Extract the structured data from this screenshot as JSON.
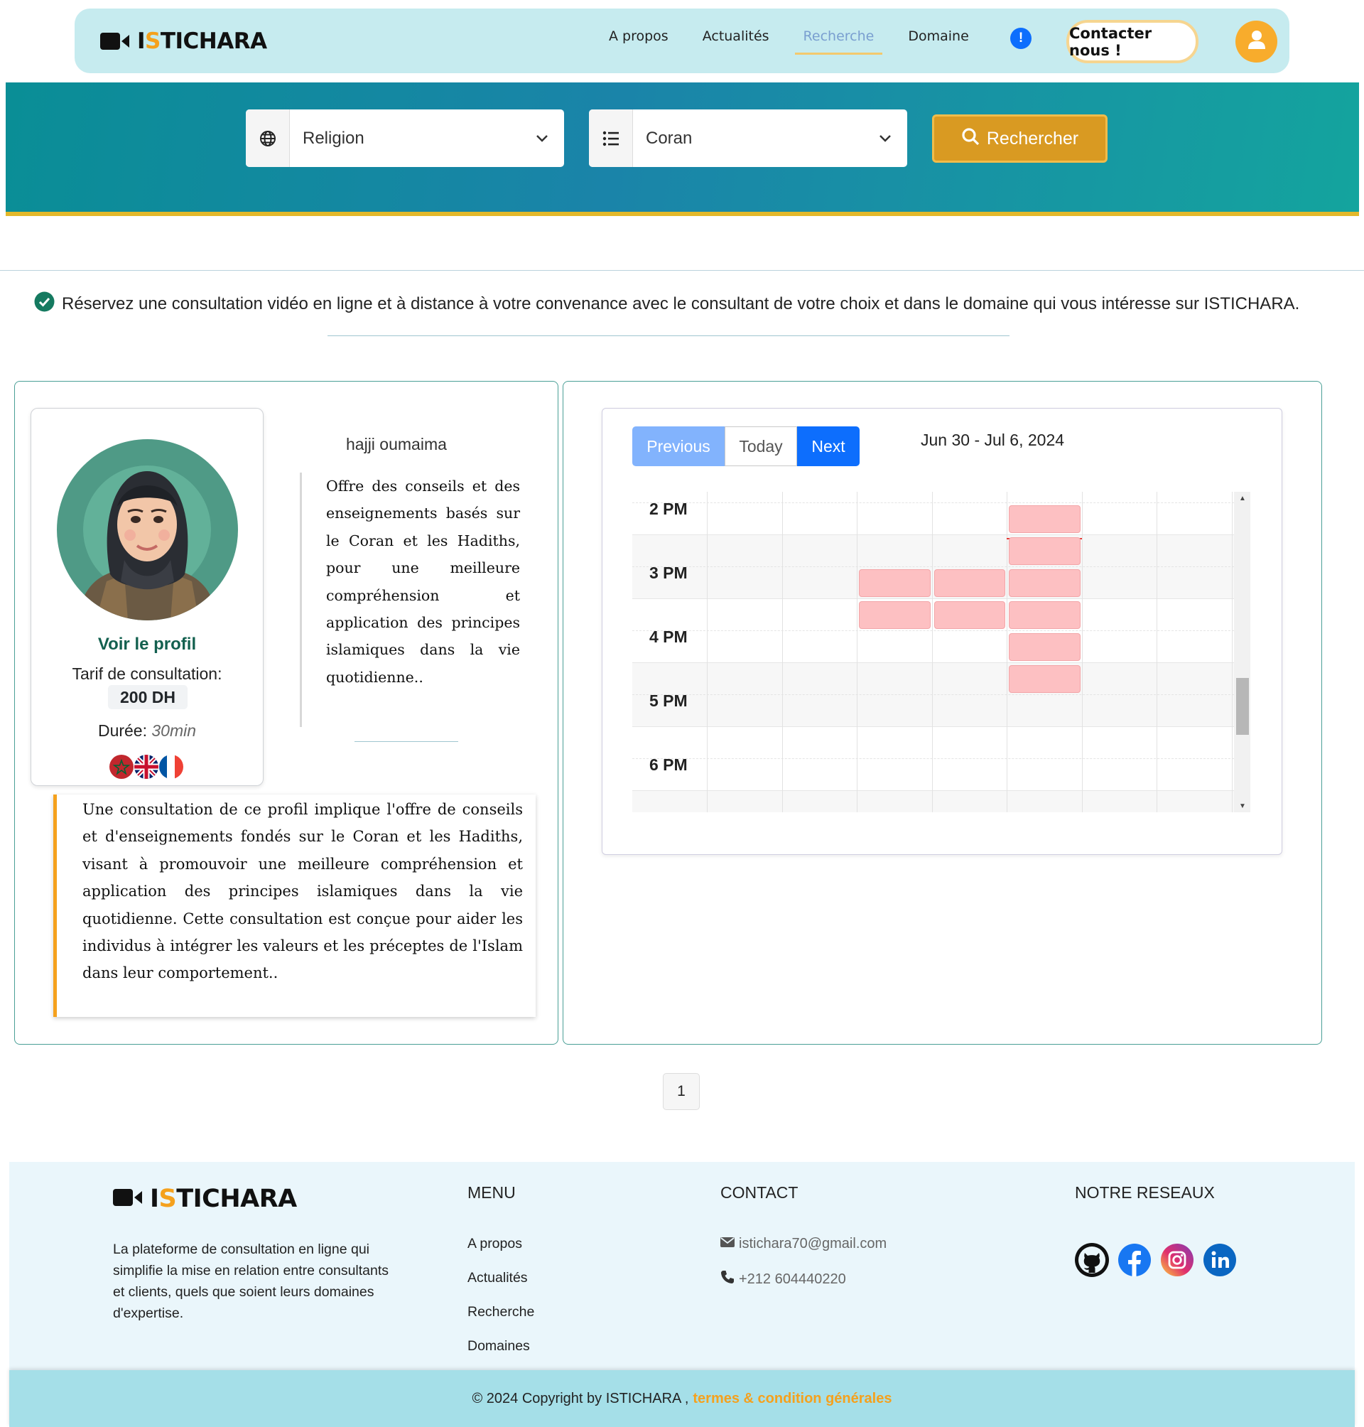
{
  "header": {
    "brand_prefix": "I",
    "brand_highlight": "S",
    "brand_suffix": "TICHARA",
    "nav": [
      {
        "label": "A propos"
      },
      {
        "label": "Actualités"
      },
      {
        "label": "Recherche",
        "active": true
      },
      {
        "label": "Domaine"
      }
    ],
    "alert_icon_text": "!",
    "contact_button": "Contacter nous !",
    "icons": {
      "brand": "video-camera-icon",
      "alert": "exclamation-circle-icon",
      "user": "user-icon"
    }
  },
  "search": {
    "domain_value": "Religion",
    "specialty_value": "Coran",
    "search_button": "Rechercher",
    "icons": {
      "domain": "globe-icon",
      "specialty": "list-icon",
      "button": "search-icon"
    }
  },
  "info": {
    "text": "Réservez une consultation vidéo en ligne et à distance à votre convenance avec le consultant de votre choix et dans le domaine qui vous intéresse sur ISTICHARA.",
    "icon": "check-circle-icon"
  },
  "consultant": {
    "name": "hajji oumaima",
    "profile_link": "Voir le profil",
    "rate_label": "Tarif de consultation:",
    "rate_value": "200 DH",
    "duration_label": "Durée:",
    "duration_value": "30min",
    "languages": [
      "morocco-flag",
      "uk-flag",
      "france-flag"
    ],
    "short_description": "Offre des conseils et des enseignements basés sur le Coran et les Hadiths, pour une meilleure compréhension et application des principes islamiques dans la vie quotidienne..",
    "description": "Une consultation de ce profil implique l'offre de conseils et d'enseignements fondés sur le Coran et les Hadiths, visant à promouvoir une meilleure compréhension et application des principes islamiques dans la vie quotidienne. Cette consultation est conçue pour aider les individus à intégrer les valeurs et les préceptes de l'Islam dans leur comportement.."
  },
  "calendar": {
    "buttons": {
      "previous": "Previous",
      "today": "Today",
      "next": "Next"
    },
    "range": "Jun 30 - Jul 6, 2024",
    "hours": [
      "2 PM",
      "3 PM",
      "4 PM",
      "5 PM",
      "6 PM"
    ],
    "events": [
      {
        "day": 5,
        "start": "14:00",
        "end": "14:30"
      },
      {
        "day": 5,
        "start": "14:30",
        "end": "15:00"
      },
      {
        "day": 3,
        "start": "15:00",
        "end": "15:30"
      },
      {
        "day": 4,
        "start": "15:00",
        "end": "15:30"
      },
      {
        "day": 5,
        "start": "15:00",
        "end": "15:30"
      },
      {
        "day": 3,
        "start": "15:30",
        "end": "16:00"
      },
      {
        "day": 4,
        "start": "15:30",
        "end": "16:00"
      },
      {
        "day": 5,
        "start": "15:30",
        "end": "16:00"
      },
      {
        "day": 5,
        "start": "16:00",
        "end": "16:30"
      },
      {
        "day": 5,
        "start": "16:30",
        "end": "17:00"
      }
    ],
    "colors": {
      "event": "#fdc0c2",
      "now_line": "#e53935"
    }
  },
  "pagination": {
    "current": "1"
  },
  "footer": {
    "about": "La plateforme de consultation en ligne qui simplifie la mise en relation entre consultants et clients, quels que soient leurs domaines d'expertise.",
    "menu_title": "MENU",
    "menu": [
      "A propos",
      "Actualités",
      "Recherche",
      "Domaines"
    ],
    "contact_title": "CONTACT",
    "email": "istichara70@gmail.com",
    "phone": "+212 604440220",
    "social_title": "NOTRE RESEAUX",
    "socials": [
      "github-icon",
      "facebook-icon",
      "instagram-icon",
      "linkedin-icon"
    ],
    "copyright": "© 2024 Copyright by ISTICHARA ,",
    "terms": "termes & condition générales"
  },
  "colors": {
    "accent": "#f5a11d",
    "primary": "#0d6efd",
    "nav_bg": "#c6ebef",
    "footer_bg": "#eaf6fb"
  }
}
